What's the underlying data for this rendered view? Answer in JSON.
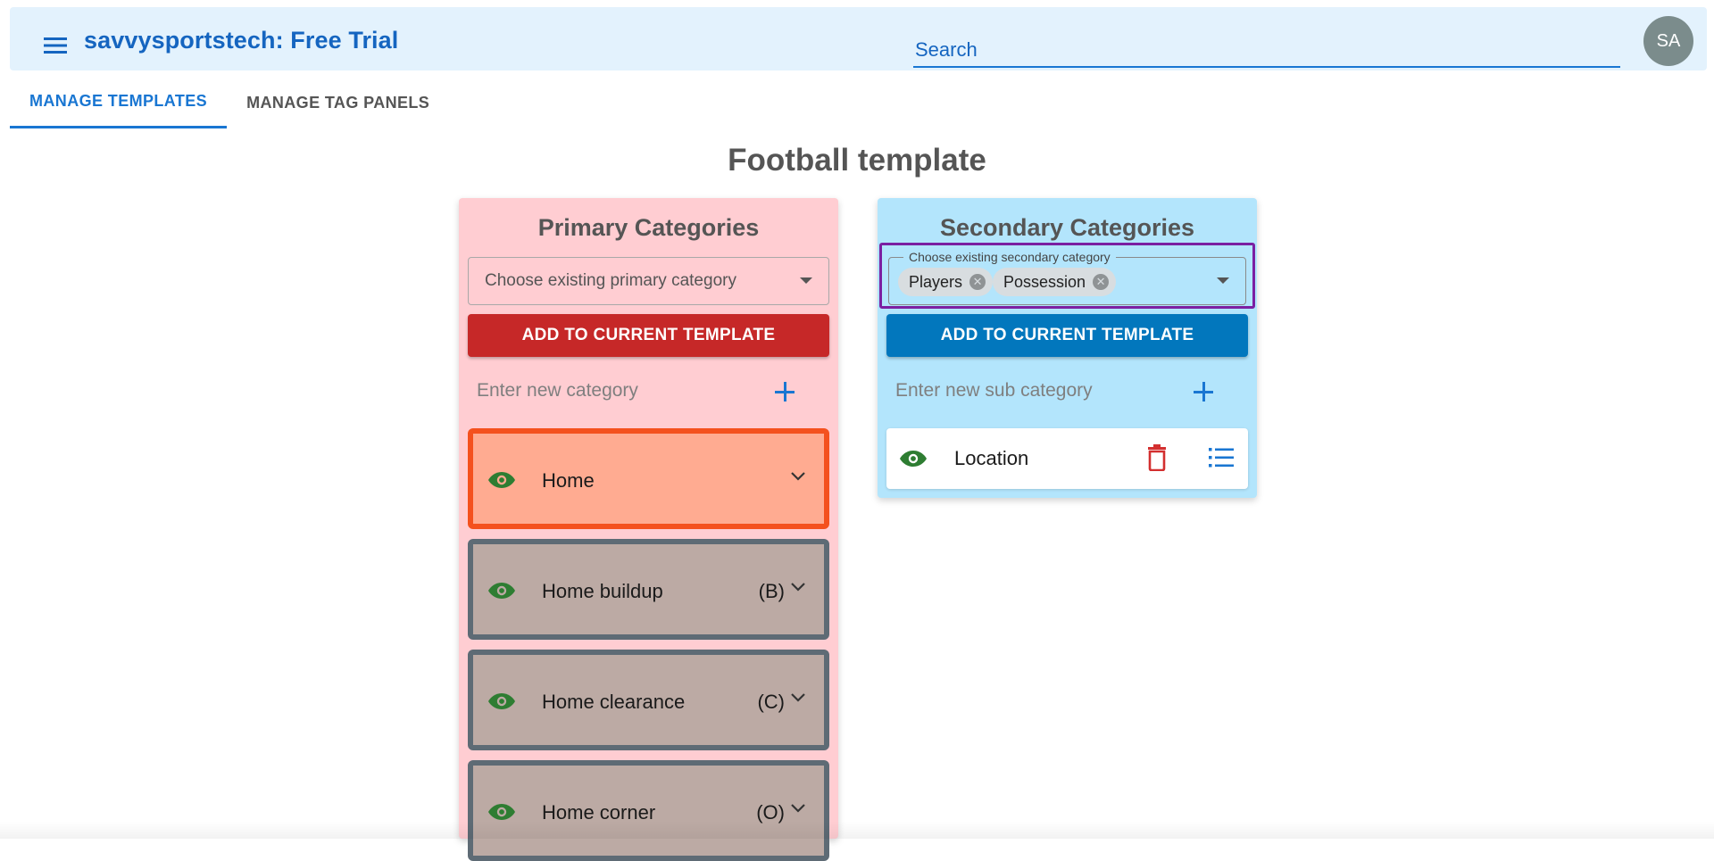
{
  "app": {
    "title": "savvysportstech: Free Trial",
    "search_placeholder": "Search",
    "avatar_initials": "SA"
  },
  "tabs": [
    {
      "label": "MANAGE TEMPLATES",
      "active": true
    },
    {
      "label": "MANAGE TAG PANELS",
      "active": false
    }
  ],
  "page": {
    "title": "Football template"
  },
  "primary": {
    "title": "Primary Categories",
    "select_placeholder": "Choose existing primary category",
    "add_button": "ADD TO CURRENT TEMPLATE",
    "new_placeholder": "Enter new category",
    "items": [
      {
        "label": "Home",
        "short": ""
      },
      {
        "label": "Home buildup",
        "short": "(B)"
      },
      {
        "label": "Home clearance",
        "short": "(C)"
      },
      {
        "label": "Home corner",
        "short": "(O)"
      }
    ]
  },
  "secondary": {
    "title": "Secondary Categories",
    "select_label": "Choose existing secondary category",
    "chips": [
      "Players",
      "Possession"
    ],
    "add_button": "ADD TO CURRENT TEMPLATE",
    "new_placeholder": "Enter new sub category",
    "items": [
      {
        "label": "Location"
      }
    ]
  },
  "colors": {
    "primary_panel": "#ffcdd2",
    "secondary_panel": "#b3e5fc",
    "home_item": "#ffab91",
    "home_border": "#f4511e",
    "item_bg": "#bcaaa4",
    "item_border": "#5e6b75",
    "red_button": "#c62828",
    "blue_button": "#0277bd",
    "focus_outline": "#7b1fa2",
    "eye_green": "#2e7d32"
  },
  "icons": {
    "menu": "hamburger-menu-icon",
    "visible": "eye-icon",
    "expand": "chevron-down-icon",
    "add": "plus-icon",
    "delete": "trash-icon",
    "list": "list-icon",
    "chip_remove": "cancel-circle-icon"
  }
}
